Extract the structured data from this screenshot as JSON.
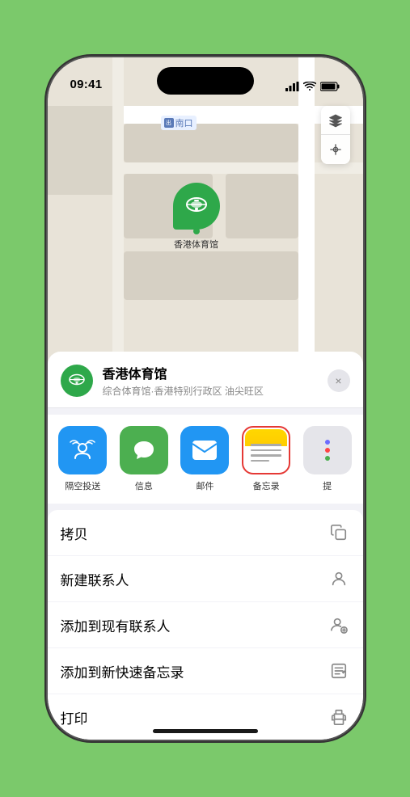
{
  "status": {
    "time": "09:41",
    "location_arrow": true
  },
  "map": {
    "label_text": "南口",
    "venue_pin_label": "香港体育馆"
  },
  "sheet": {
    "venue_name": "香港体育馆",
    "venue_sub": "综合体育馆·香港特别行政区 油尖旺区",
    "close_label": "×"
  },
  "share_items": [
    {
      "id": "airdrop",
      "label": "隔空投送",
      "color": "#2196f3"
    },
    {
      "id": "messages",
      "label": "信息",
      "color": "#4caf50"
    },
    {
      "id": "mail",
      "label": "邮件",
      "color": "#2196f3"
    },
    {
      "id": "notes",
      "label": "备忘录",
      "color": "#ffd700"
    },
    {
      "id": "more",
      "label": "提",
      "color": "#e0e0e0"
    }
  ],
  "actions": [
    {
      "label": "拷贝",
      "icon": "copy"
    },
    {
      "label": "新建联系人",
      "icon": "person-add"
    },
    {
      "label": "添加到现有联系人",
      "icon": "person-check"
    },
    {
      "label": "添加到新快速备忘录",
      "icon": "note"
    },
    {
      "label": "打印",
      "icon": "print"
    }
  ],
  "controls": {
    "map_icon": "map",
    "location_icon": "location"
  }
}
